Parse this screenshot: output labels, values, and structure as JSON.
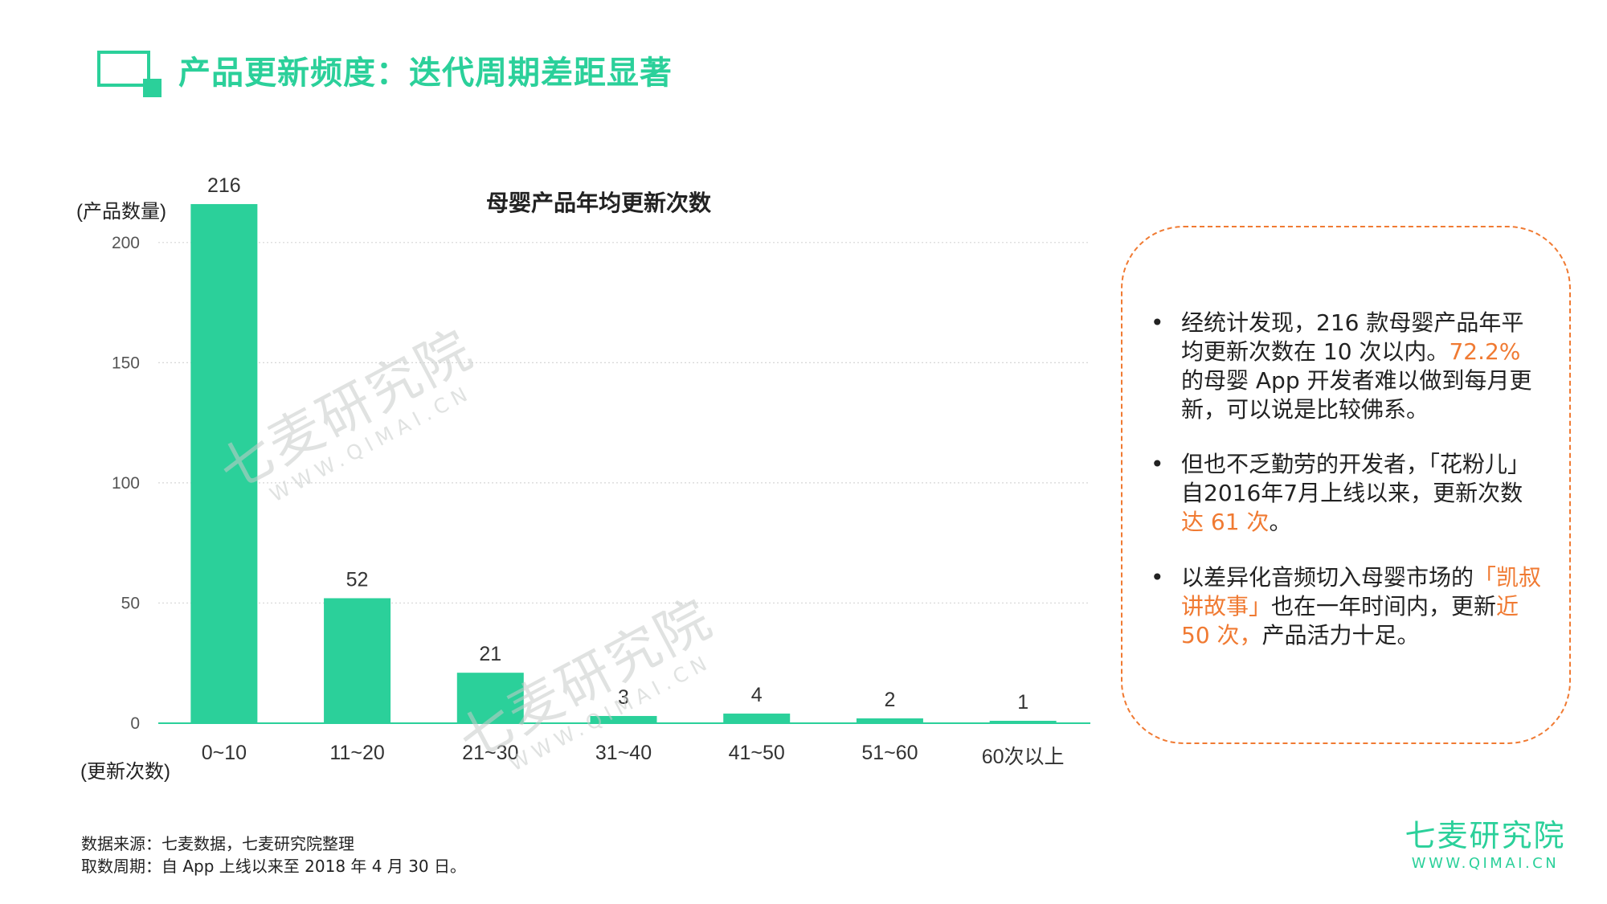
{
  "header": {
    "title": "产品更新频度：迭代周期差距显著"
  },
  "chart_data": {
    "type": "bar",
    "title": "母婴产品年均更新次数",
    "ylabel": "(产品数量)",
    "xlabel": "(更新次数)",
    "categories": [
      "0~10",
      "11~20",
      "21~30",
      "31~40",
      "41~50",
      "51~60",
      "60次以上"
    ],
    "values": [
      216,
      52,
      21,
      3,
      4,
      2,
      1
    ],
    "ylim": [
      0,
      220
    ],
    "yticks": [
      0,
      50,
      100,
      150,
      200
    ],
    "grid": true,
    "bar_color": "#2bd09a"
  },
  "callout": {
    "bullets": [
      {
        "segments": [
          {
            "text": "经统计发现，216 款母婴产品年平均更新次数在 10 次以内。",
            "highlight": false
          },
          {
            "text": "72.2%",
            "highlight": true
          },
          {
            "text": "的母婴 App 开发者难以做到每月更新，可以说是比较佛系。",
            "highlight": false
          }
        ]
      },
      {
        "segments": [
          {
            "text": "但也不乏勤劳的开发者，「花粉儿」自2016年7月上线以来，更新次数",
            "highlight": false
          },
          {
            "text": "达 61 次",
            "highlight": true
          },
          {
            "text": "。",
            "highlight": false
          }
        ]
      },
      {
        "segments": [
          {
            "text": "以差异化音频切入母婴市场的",
            "highlight": false
          },
          {
            "text": "「凯叔讲故事」",
            "highlight": true
          },
          {
            "text": "也在一年时间内，更新",
            "highlight": false
          },
          {
            "text": "近 50 次，",
            "highlight": true
          },
          {
            "text": "产品活力十足。",
            "highlight": false
          }
        ]
      }
    ],
    "bullet_symbol": "•"
  },
  "footer": {
    "source_line": "数据来源：七麦数据，七麦研究院整理",
    "period_line": "取数周期：自 App 上线以来至 2018 年 4 月 30 日。"
  },
  "brand": {
    "name": "七麦研究院",
    "url": "WWW.QIMAI.CN"
  },
  "watermark": {
    "name": "七麦研究院",
    "url": "WWW.QIMAI.CN"
  },
  "colors": {
    "accent_green": "#2bd09a",
    "highlight_orange": "#f07a32"
  }
}
